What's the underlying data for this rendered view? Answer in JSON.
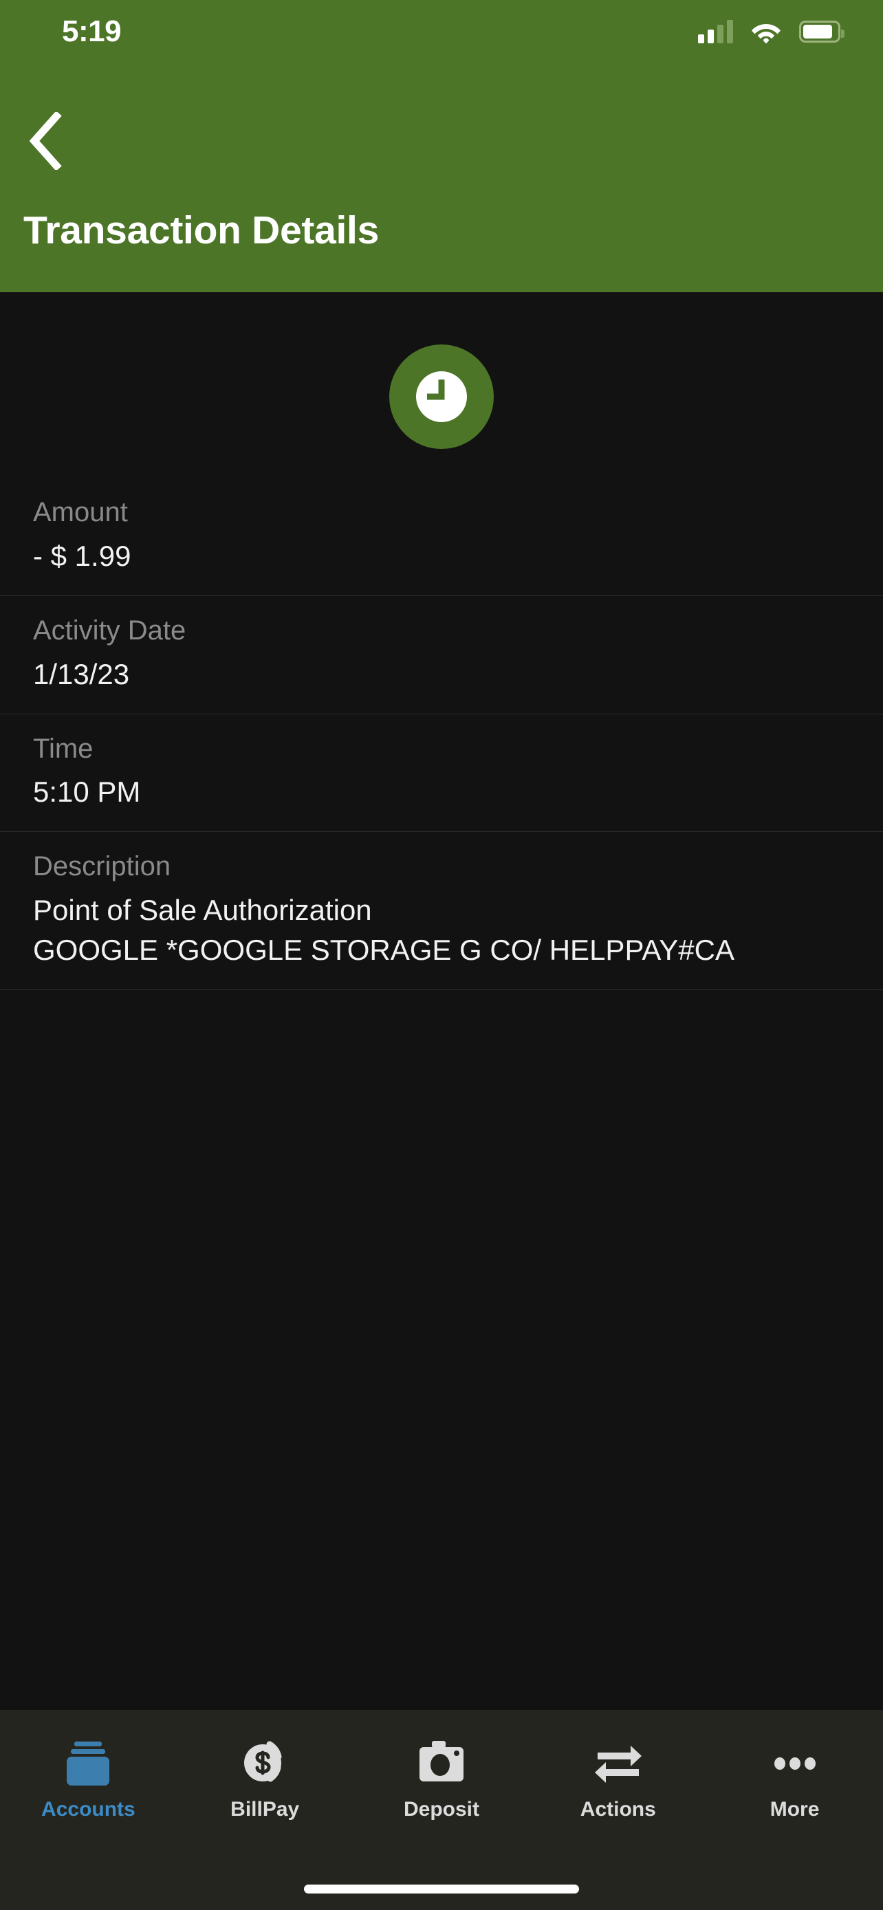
{
  "status_bar": {
    "time": "5:19",
    "signal_icon": "cellular-signal-icon",
    "wifi_icon": "wifi-icon",
    "battery_icon": "battery-icon"
  },
  "header": {
    "back_icon": "chevron-left-icon",
    "title": "Transaction Details",
    "background_color": "#4d7527"
  },
  "main": {
    "status_icon": "clock-icon",
    "status_icon_color": "#4d7527",
    "rows": [
      {
        "label": "Amount",
        "value": "- $ 1.99"
      },
      {
        "label": "Activity Date",
        "value": "1/13/23"
      },
      {
        "label": "Time",
        "value": "5:10 PM"
      },
      {
        "label": "Description",
        "value": "Point of Sale Authorization\nGOOGLE *GOOGLE STORAGE G CO/ HELPPAY#CA"
      }
    ]
  },
  "tabbar": {
    "active_color": "#3c8bc6",
    "items": [
      {
        "label": "Accounts",
        "icon": "accounts-cards-icon",
        "active": true
      },
      {
        "label": "BillPay",
        "icon": "dollar-coin-icon",
        "active": false
      },
      {
        "label": "Deposit",
        "icon": "camera-icon",
        "active": false
      },
      {
        "label": "Actions",
        "icon": "transfer-arrows-icon",
        "active": false
      },
      {
        "label": "More",
        "icon": "ellipsis-icon",
        "active": false
      }
    ],
    "home_indicator": "home-indicator"
  }
}
